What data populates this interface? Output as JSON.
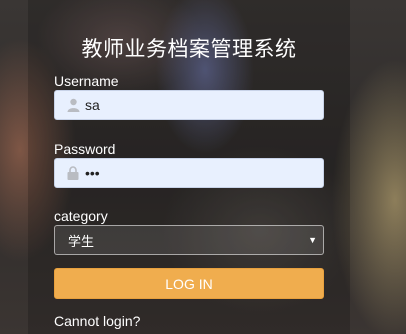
{
  "app": {
    "title": "教师业务档案管理系统"
  },
  "form": {
    "username_label": "Username",
    "username_value": "sa",
    "username_icon": "user-icon",
    "password_label": "Password",
    "password_value": "•••",
    "password_icon": "lock-icon",
    "category_label": "category",
    "category_selected": "学生",
    "login_button": "LOG IN",
    "cannot_login_link": "Cannot login?"
  },
  "colors": {
    "accent": "#f0ad4e",
    "input_bg": "#e8f0fe",
    "text": "#ffffff"
  }
}
